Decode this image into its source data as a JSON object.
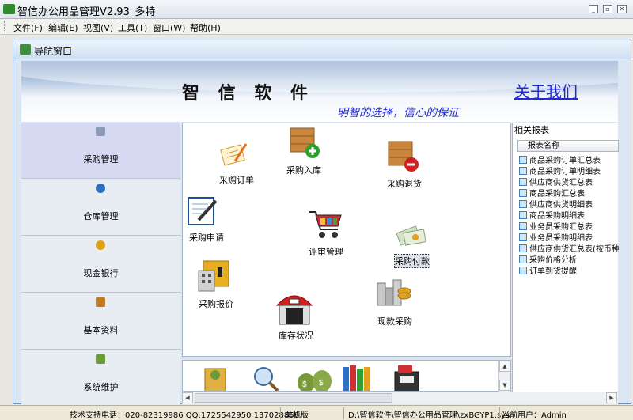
{
  "window": {
    "title": "智信办公用品管理V2.93_多特"
  },
  "menu": [
    "文件(F)",
    "编辑(E)",
    "视图(V)",
    "工具(T)",
    "窗口(W)",
    "帮助(H)"
  ],
  "child_window": {
    "title": "导航窗口"
  },
  "banner": {
    "brand": "智 信 软 件",
    "about": "关于我们",
    "slogan": "明智的选择，信心的保证"
  },
  "left_nav": [
    {
      "label": "采购管理",
      "icon": "purchase-icon",
      "color": "#8a9bb5"
    },
    {
      "label": "仓库管理",
      "icon": "warehouse-icon",
      "color": "#2f6fc0"
    },
    {
      "label": "现金银行",
      "icon": "cash-icon",
      "color": "#e0a010"
    },
    {
      "label": "基本资料",
      "icon": "basic-data-icon",
      "color": "#c07a20"
    },
    {
      "label": "系统维护",
      "icon": "system-icon",
      "color": "#6a9a3a"
    }
  ],
  "flow_items": {
    "order": "采购订单",
    "stock_in": "采购入库",
    "return": "采购退货",
    "request": "采购申请",
    "review": "评审管理",
    "payment": "采购付款",
    "quote": "采购报价",
    "stock_status": "库存状况",
    "cash_purchase": "现款采购"
  },
  "reports": {
    "header": "相关报表",
    "column": "报表名称",
    "items": [
      "商品采购订单汇总表",
      "商品采购订单明细表",
      "供应商供货汇总表",
      "商品采购汇总表",
      "供应商供货明细表",
      "商品采购明细表",
      "业务员采购汇总表",
      "业务员采购明细表",
      "供应商供货汇总表(按币种分",
      "采购价格分析",
      "订单到货提醒"
    ]
  },
  "status": {
    "support": "技术支持电话：020-82319986 QQ:1725542950 137028856",
    "edition": "单机版",
    "path": "D:\\智信软件\\智信办公用品管理\\zxBGYP1.sys",
    "user": "当前用户：Admin"
  }
}
